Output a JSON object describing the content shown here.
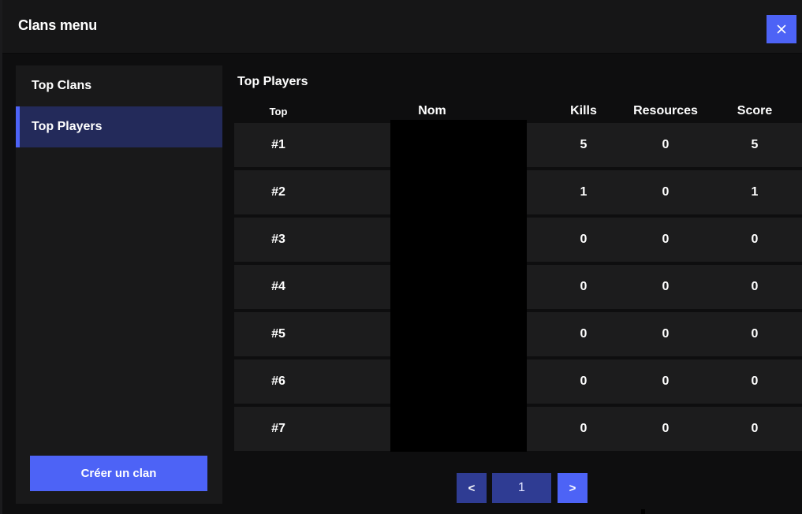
{
  "window": {
    "title": "Clans menu",
    "close_icon": "close-icon",
    "accent_color": "#4d63f6"
  },
  "sidebar": {
    "items": [
      {
        "label": "Top Clans",
        "active": false
      },
      {
        "label": "Top Players",
        "active": true
      }
    ],
    "create_button": "Créer un clan"
  },
  "main": {
    "section_title": "Top Players",
    "columns": [
      "Top",
      "Nom",
      "Kills",
      "Resources",
      "Score"
    ],
    "rows": [
      {
        "rank": "#1",
        "kills": "5",
        "resources": "0",
        "score": "5"
      },
      {
        "rank": "#2",
        "kills": "1",
        "resources": "0",
        "score": "1"
      },
      {
        "rank": "#3",
        "kills": "0",
        "resources": "0",
        "score": "0"
      },
      {
        "rank": "#4",
        "kills": "0",
        "resources": "0",
        "score": "0"
      },
      {
        "rank": "#5",
        "kills": "0",
        "resources": "0",
        "score": "0"
      },
      {
        "rank": "#6",
        "kills": "0",
        "resources": "0",
        "score": "0"
      },
      {
        "rank": "#7",
        "kills": "0",
        "resources": "0",
        "score": "0"
      }
    ]
  },
  "pagination": {
    "prev": "<",
    "page": "1",
    "next": ">"
  }
}
